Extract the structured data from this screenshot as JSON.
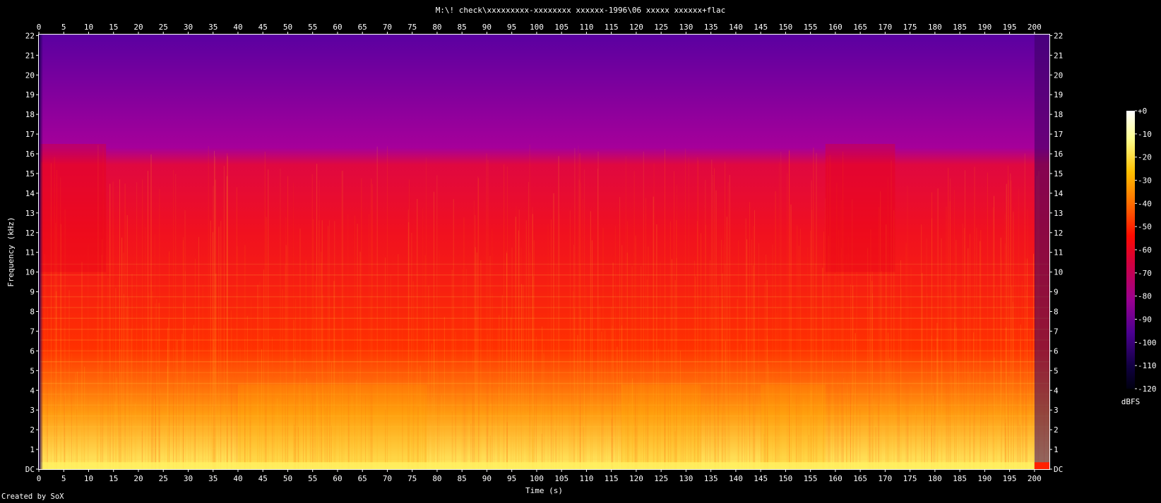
{
  "chart_data": {
    "type": "heatmap",
    "title": "M:\\! check\\xxxxxxxxx-xxxxxxxx xxxxxx-1996\\06 xxxxx xxxxxx+flac",
    "xlabel": "Time (s)",
    "ylabel": "Frequency (kHz)",
    "xlim": [
      0,
      203
    ],
    "ylim": [
      0,
      22.05
    ],
    "x_ticks": [
      "0",
      "5",
      "10",
      "15",
      "20",
      "25",
      "30",
      "35",
      "40",
      "45",
      "50",
      "55",
      "60",
      "65",
      "70",
      "75",
      "80",
      "85",
      "90",
      "95",
      "100",
      "105",
      "110",
      "115",
      "120",
      "125",
      "130",
      "135",
      "140",
      "145",
      "150",
      "155",
      "160",
      "165",
      "170",
      "175",
      "180",
      "185",
      "190",
      "195",
      "200"
    ],
    "y_ticks": [
      "DC",
      "1",
      "2",
      "3",
      "4",
      "5",
      "6",
      "7",
      "8",
      "9",
      "10",
      "11",
      "12",
      "13",
      "14",
      "15",
      "16",
      "17",
      "18",
      "19",
      "20",
      "21",
      "22"
    ],
    "colorbar": {
      "label": "dBFS",
      "ticks": [
        "+0",
        "-10",
        "-20",
        "-30",
        "-40",
        "-50",
        "-60",
        "-70",
        "-80",
        "-90",
        "-100",
        "-110",
        "-120"
      ]
    },
    "bandwidth_cutoff_khz": 16.5,
    "quiet_sections_s": [
      [
        0,
        13.5
      ],
      [
        158,
        172
      ]
    ],
    "dense_midrange_sections_s": [
      [
        40,
        78
      ],
      [
        117,
        133
      ],
      [
        145,
        158
      ]
    ],
    "ending_fadeout_s": [
      200,
      203
    ],
    "colors": {
      "high": "#ffffd0",
      "mid": "#ff2000",
      "low": "#8a009a",
      "floor": "#000010"
    }
  },
  "footer": "Created by SoX"
}
